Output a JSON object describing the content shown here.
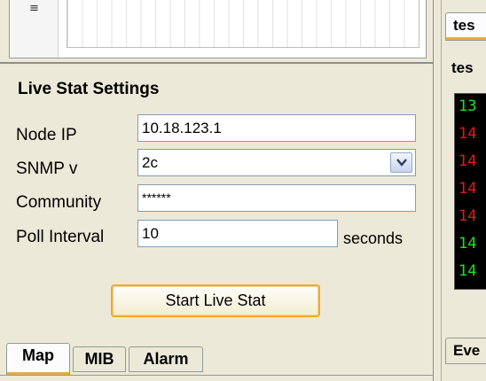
{
  "chart": {
    "axis_glyph": "≡"
  },
  "settings": {
    "title": "Live Stat Settings",
    "node_ip_label": "Node IP",
    "node_ip_value": "10.18.123.1",
    "snmp_label": "SNMP v",
    "snmp_value": "2c",
    "community_label": "Community",
    "community_value": "******",
    "poll_label": "Poll Interval",
    "poll_value": "10",
    "poll_unit": "seconds",
    "start_button": "Start Live Stat"
  },
  "bottom_tabs": [
    {
      "label": "Map",
      "active": true
    },
    {
      "label": "MIB",
      "active": false
    },
    {
      "label": "Alarm",
      "active": false
    }
  ],
  "right_panel": {
    "tab_label": "tes",
    "title": "tes",
    "console_lines": [
      {
        "text": "13",
        "color": "#19e619"
      },
      {
        "text": "14",
        "color": "#e61919"
      },
      {
        "text": "14",
        "color": "#e61919"
      },
      {
        "text": "14",
        "color": "#e61919"
      },
      {
        "text": "14",
        "color": "#e61919"
      },
      {
        "text": "14",
        "color": "#19e619"
      },
      {
        "text": "14",
        "color": "#19e619"
      }
    ],
    "bottom_tab_label": "Eve"
  },
  "colors": {
    "accent": "#f0a93f",
    "field_border": "#7f9db9",
    "panel_bg": "#ece9d8"
  }
}
